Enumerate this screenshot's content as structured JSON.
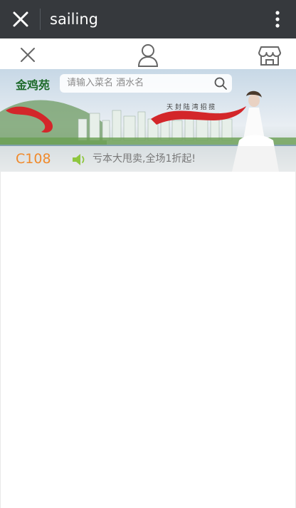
{
  "window": {
    "title": "sailing"
  },
  "banner": {
    "logo_text": "金鸡苑",
    "slogan": "天 封 陆 湾 招 揽"
  },
  "search": {
    "placeholder": "请输入菜名 酒水名"
  },
  "notice": {
    "code": "C108",
    "message": "亏本大甩卖,全场1折起!"
  },
  "colors": {
    "topbar": "#36393d",
    "accent_orange": "#f08a2c",
    "speaker_green": "#8ec63f"
  },
  "icons": {
    "close": "close-icon",
    "more": "more-vertical-icon",
    "user": "user-icon",
    "store": "store-icon",
    "search": "search-icon",
    "speaker": "speaker-icon"
  }
}
